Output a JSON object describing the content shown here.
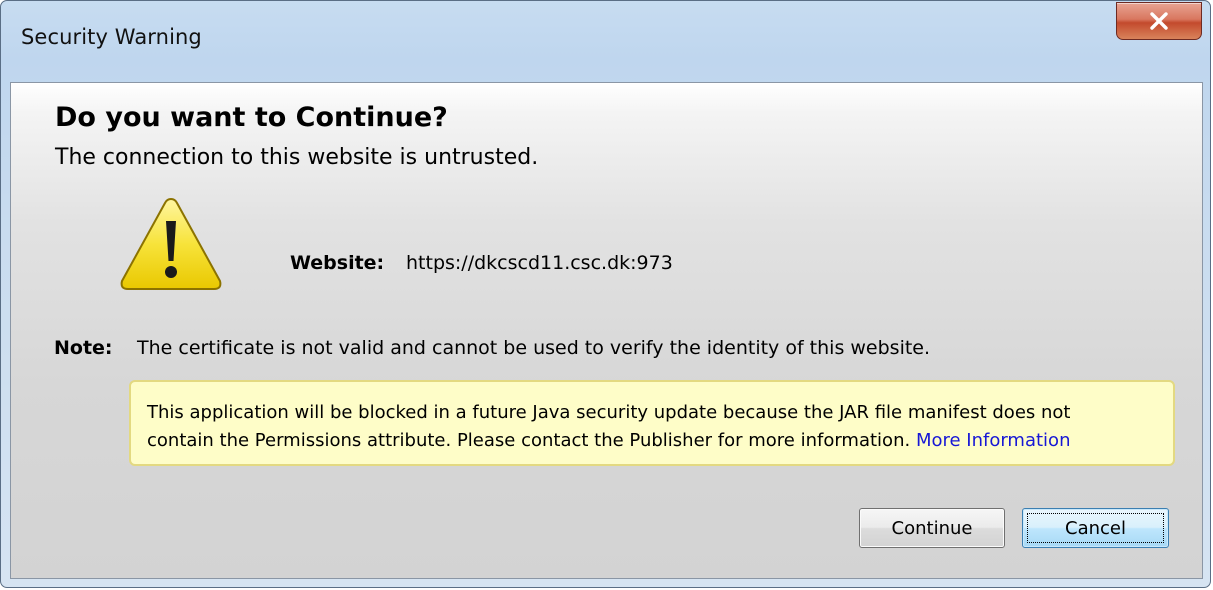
{
  "window": {
    "title": "Security Warning",
    "close_icon": "close-x-icon"
  },
  "dialog": {
    "heading": "Do you want to Continue?",
    "subheading": "The connection to this website is untrusted.",
    "icon": "warning-triangle-icon",
    "website_label": "Website:",
    "website_value": "https://dkcscd11.csc.dk:973",
    "note_label": "Note:",
    "note_text": "The certificate is not valid and cannot be used to verify the identity of this website.",
    "info_line1": "This application will be blocked in a future Java security update because the JAR file manifest does not",
    "info_line2": "contain the Permissions attribute. Please contact the Publisher for more information.",
    "more_info_link": "More Information"
  },
  "buttons": {
    "continue_label": "Continue",
    "cancel_label": "Cancel"
  },
  "colors": {
    "info_background": "#fefdc8",
    "link": "#1717d6",
    "close_button": "#c34a2d",
    "warning_icon": "#f5d90f"
  }
}
